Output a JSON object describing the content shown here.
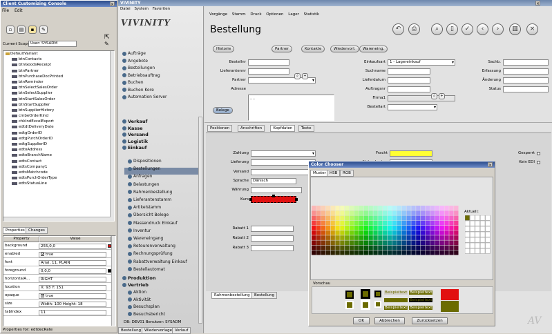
{
  "left_window": {
    "title": "Client Customizing Console",
    "menu": [
      "File",
      "Edit"
    ],
    "scope_label": "Current Scope:",
    "scope_value": "User: SYSADM",
    "tree_root": "DefaultVariant",
    "tree_items": [
      "btnContacts",
      "btnGoodsReceipt",
      "btnPartner",
      "btnPurchaseDocPrinted",
      "btnReminder",
      "btnSelectSalesOrder",
      "btnSelectSupplier",
      "btnStartSalesOrder",
      "btnStartSupplier",
      "btnSupplierHistory",
      "cmbeOrderKind",
      "chkIndExcelExport",
      "edtdtDeliveryDate",
      "edtgOrderID",
      "edtgPurchOrderID",
      "edtgSupplierID",
      "edtoAddress",
      "edtoBranchName",
      "edtsContact",
      "edtsCompany1",
      "edtsMatchcode",
      "edtsPurchOrderType",
      "edtsStatusLine"
    ],
    "tabs": [
      "Properties",
      "Changes"
    ],
    "prop_headers": [
      "Property",
      "Value"
    ],
    "props": [
      {
        "k": "background",
        "v": "255,0,0"
      },
      {
        "k": "enabled",
        "v": "true"
      },
      {
        "k": "font",
        "v": "Arial, 11, PLAIN"
      },
      {
        "k": "foreground",
        "v": "0,0,0"
      },
      {
        "k": "horizontalA...",
        "v": "RIGHT"
      },
      {
        "k": "location",
        "v": "X: 93   Y: 151"
      },
      {
        "k": "opaque",
        "v": "true"
      },
      {
        "k": "size",
        "v": "Width: 100   Height: 18"
      },
      {
        "k": "tabIndex",
        "v": "11"
      }
    ],
    "footer": "Properties for:  edtdecRate"
  },
  "main_window": {
    "title": "VIVINITY",
    "brand": "VIVINITY",
    "left_menu": [
      "Datei",
      "System",
      "Favoriten"
    ],
    "top_menu": [
      "Vorgänge",
      "Stamm",
      "Druck",
      "Optionen",
      "Lager",
      "Statistik"
    ],
    "page_title": "Bestellung",
    "toolbar_icons": [
      "undo-icon",
      "print-icon",
      "search-icon",
      "document-icon",
      "check-icon",
      "back-icon",
      "forward-icon",
      "delete-icon",
      "close-icon"
    ],
    "nav_top": [
      "Aufträge",
      "Angebote",
      "Bestellungen",
      "Betriebsauftrag",
      "Buchen",
      "Buchen Kore",
      "Automation Server"
    ],
    "nav_sections": [
      "Verkauf",
      "Kasse",
      "Versand",
      "Logistik",
      "Einkauf"
    ],
    "nav_einkauf": [
      "Dispositionen",
      "Bestellungen",
      "Anfragen",
      "Belastungen",
      "Rahmenbestellung",
      "Lieferantenstamm",
      "Artikelstamm",
      "Übersicht Belege",
      "Massendruck Einkauf",
      "Inventur",
      "Wareneingang",
      "Retourenverwaltung",
      "Rechnungsprüfung",
      "Rabattverwaltung Einkauf",
      "Bestellautomat"
    ],
    "nav_bottom_sections": [
      "Produktion",
      "Vertrieb"
    ],
    "nav_vertrieb": [
      "Aktion",
      "Aktivität",
      "Besuchsplan",
      "Besuchsbericht"
    ],
    "status_db": "DB: DEV01  Benutzer: SYSADM",
    "bottom_tabs_left": [
      "Bestellung",
      "Wiedervorlage",
      "Verlauf"
    ],
    "buttons": {
      "historie": "Historie",
      "partner": "Partner",
      "kontakte": "Kontakte",
      "wiedervorl": "Wiedervorl.",
      "wareneing": "Wareneing.",
      "belege": "Belege"
    },
    "form_left": [
      "Bestellnr",
      "Lieferantennr",
      "Partner",
      "Adresse"
    ],
    "adresse_value": "....",
    "form_mid": [
      "Einkaufsart",
      "Suchname",
      "Lieferdatum",
      "Auftragsnr",
      "Firma1",
      "Bestellart"
    ],
    "einkaufsart_value": "1 - Lagereinkauf",
    "form_right": [
      "Sachb.",
      "Erfassung",
      "Änderung",
      "Status"
    ],
    "tabs": [
      "Positionen",
      "Anschriften",
      "Kopfdaten",
      "Texte"
    ],
    "kopf_left": [
      "Zahlung",
      "Lieferung",
      "Versand",
      "Sprache",
      "Währung",
      "Kurs"
    ],
    "sprache_value": "Dänisch",
    "rabatt": [
      "Rabatt 1",
      "Rabatt 2",
      "Rabatt 3"
    ],
    "kopf_mid": [
      "Fracht",
      "Nebenkosten"
    ],
    "kopf_right": [
      "Gesperrt",
      "Kein EDI"
    ],
    "bottom_tabs": [
      "Rahmenbestellung",
      "Bestellung"
    ]
  },
  "dialog": {
    "title": "Color Chooser",
    "tabs": [
      "Muster",
      "HSB",
      "RGB"
    ],
    "recent_label": "Aktuell:",
    "preview_label": "Vorschau",
    "sample_text": "Beispieltext",
    "buttons": [
      "OK",
      "Abbrechen",
      "Zurücksetzen"
    ]
  },
  "colors": {
    "red": "#e11010",
    "yellow": "#ffff33",
    "olive": "#6b6b00"
  }
}
